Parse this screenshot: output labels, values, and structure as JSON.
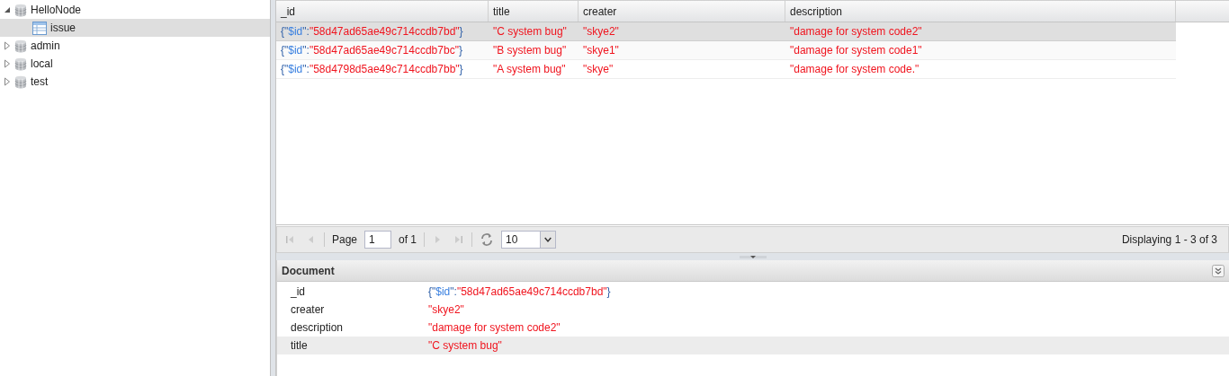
{
  "tree": [
    {
      "label": "HelloNode",
      "expanded": true,
      "selected": false,
      "children": [
        {
          "label": "issue",
          "selected": true
        }
      ]
    },
    {
      "label": "admin",
      "expanded": false,
      "selected": false
    },
    {
      "label": "local",
      "expanded": false,
      "selected": false
    },
    {
      "label": "test",
      "expanded": false,
      "selected": false
    }
  ],
  "grid": {
    "columns": [
      "_id",
      "title",
      "creater",
      "description"
    ],
    "rows": [
      {
        "selected": true,
        "cells": [
          [
            {
              "kind": "punct",
              "text": "{\""
            },
            {
              "kind": "key",
              "text": "$id"
            },
            {
              "kind": "punct",
              "text": "\":"
            },
            {
              "kind": "string",
              "text": "\"58d47ad65ae49c714ccdb7bd\""
            },
            {
              "kind": "punct",
              "text": "}"
            }
          ],
          [
            {
              "kind": "string",
              "text": "\"C system bug\""
            }
          ],
          [
            {
              "kind": "string",
              "text": "\"skye2\""
            }
          ],
          [
            {
              "kind": "string",
              "text": "\"damage for system code2\""
            }
          ]
        ]
      },
      {
        "selected": false,
        "cells": [
          [
            {
              "kind": "punct",
              "text": "{\""
            },
            {
              "kind": "key",
              "text": "$id"
            },
            {
              "kind": "punct",
              "text": "\":"
            },
            {
              "kind": "string",
              "text": "\"58d47ad65ae49c714ccdb7bc\""
            },
            {
              "kind": "punct",
              "text": "}"
            }
          ],
          [
            {
              "kind": "string",
              "text": "\"B system bug\""
            }
          ],
          [
            {
              "kind": "string",
              "text": "\"skye1\""
            }
          ],
          [
            {
              "kind": "string",
              "text": "\"damage for system code1\""
            }
          ]
        ]
      },
      {
        "selected": false,
        "cells": [
          [
            {
              "kind": "punct",
              "text": "{\""
            },
            {
              "kind": "key",
              "text": "$id"
            },
            {
              "kind": "punct",
              "text": "\":"
            },
            {
              "kind": "string",
              "text": "\"58d4798d5ae49c714ccdb7bb\""
            },
            {
              "kind": "punct",
              "text": "}"
            }
          ],
          [
            {
              "kind": "string",
              "text": "\"A system bug\""
            }
          ],
          [
            {
              "kind": "string",
              "text": "\"skye\""
            }
          ],
          [
            {
              "kind": "string",
              "text": "\"damage for system code.\""
            }
          ]
        ]
      }
    ]
  },
  "pager": {
    "page_label": "Page",
    "page": "1",
    "of": "of 1",
    "page_size": "10",
    "summary": "Displaying 1 - 3 of 3"
  },
  "document": {
    "title": "Document",
    "rows": [
      {
        "selected": false,
        "key": "_id",
        "value": [
          {
            "kind": "punct",
            "text": "{\""
          },
          {
            "kind": "key",
            "text": "$id"
          },
          {
            "kind": "punct",
            "text": "\":"
          },
          {
            "kind": "string",
            "text": "\"58d47ad65ae49c714ccdb7bd\""
          },
          {
            "kind": "punct",
            "text": "}"
          }
        ]
      },
      {
        "selected": false,
        "key": "creater",
        "value": [
          {
            "kind": "string",
            "text": "\"skye2\""
          }
        ]
      },
      {
        "selected": false,
        "key": "description",
        "value": [
          {
            "kind": "string",
            "text": "\"damage for system code2\""
          }
        ]
      },
      {
        "selected": true,
        "key": "title",
        "value": [
          {
            "kind": "string",
            "text": "\"C system bug\""
          }
        ]
      }
    ]
  }
}
